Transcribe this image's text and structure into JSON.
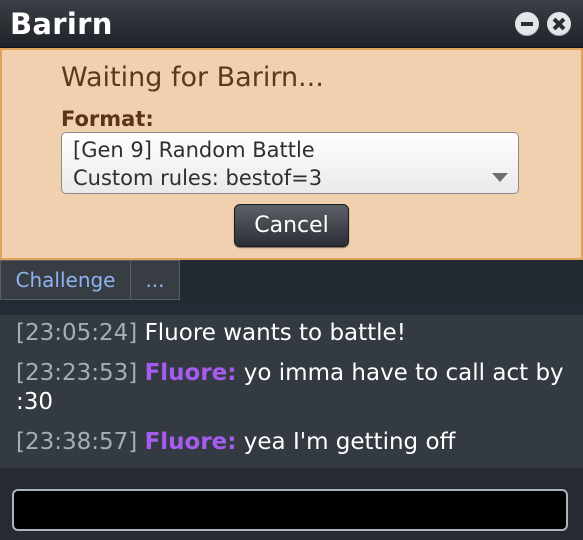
{
  "window": {
    "title": "Barirn",
    "minimize_icon": "minimize-icon",
    "close_icon": "close-icon"
  },
  "challenge": {
    "waiting_text": "Waiting for Barirn...",
    "format_label": "Format:",
    "format_line1": "[Gen 9] Random Battle",
    "format_line2": "Custom rules: bestof=3",
    "cancel_label": "Cancel"
  },
  "tabs": [
    {
      "label": "Challenge"
    },
    {
      "label": "..."
    }
  ],
  "chat": [
    {
      "time": "[23:05:24]",
      "user": "",
      "message": "Fluore wants to battle!"
    },
    {
      "time": "[23:23:53]",
      "user": "Fluore:",
      "message": "yo imma have to call act by :30"
    },
    {
      "time": "[23:38:57]",
      "user": "Fluore:",
      "message": "yea I'm getting off"
    }
  ],
  "input": {
    "value": "",
    "placeholder": ""
  },
  "colors": {
    "panel_bg": "#f1d0b0",
    "panel_border": "#e0a15c",
    "username": "#a65cf0",
    "tab_text": "#8fb3f0"
  }
}
